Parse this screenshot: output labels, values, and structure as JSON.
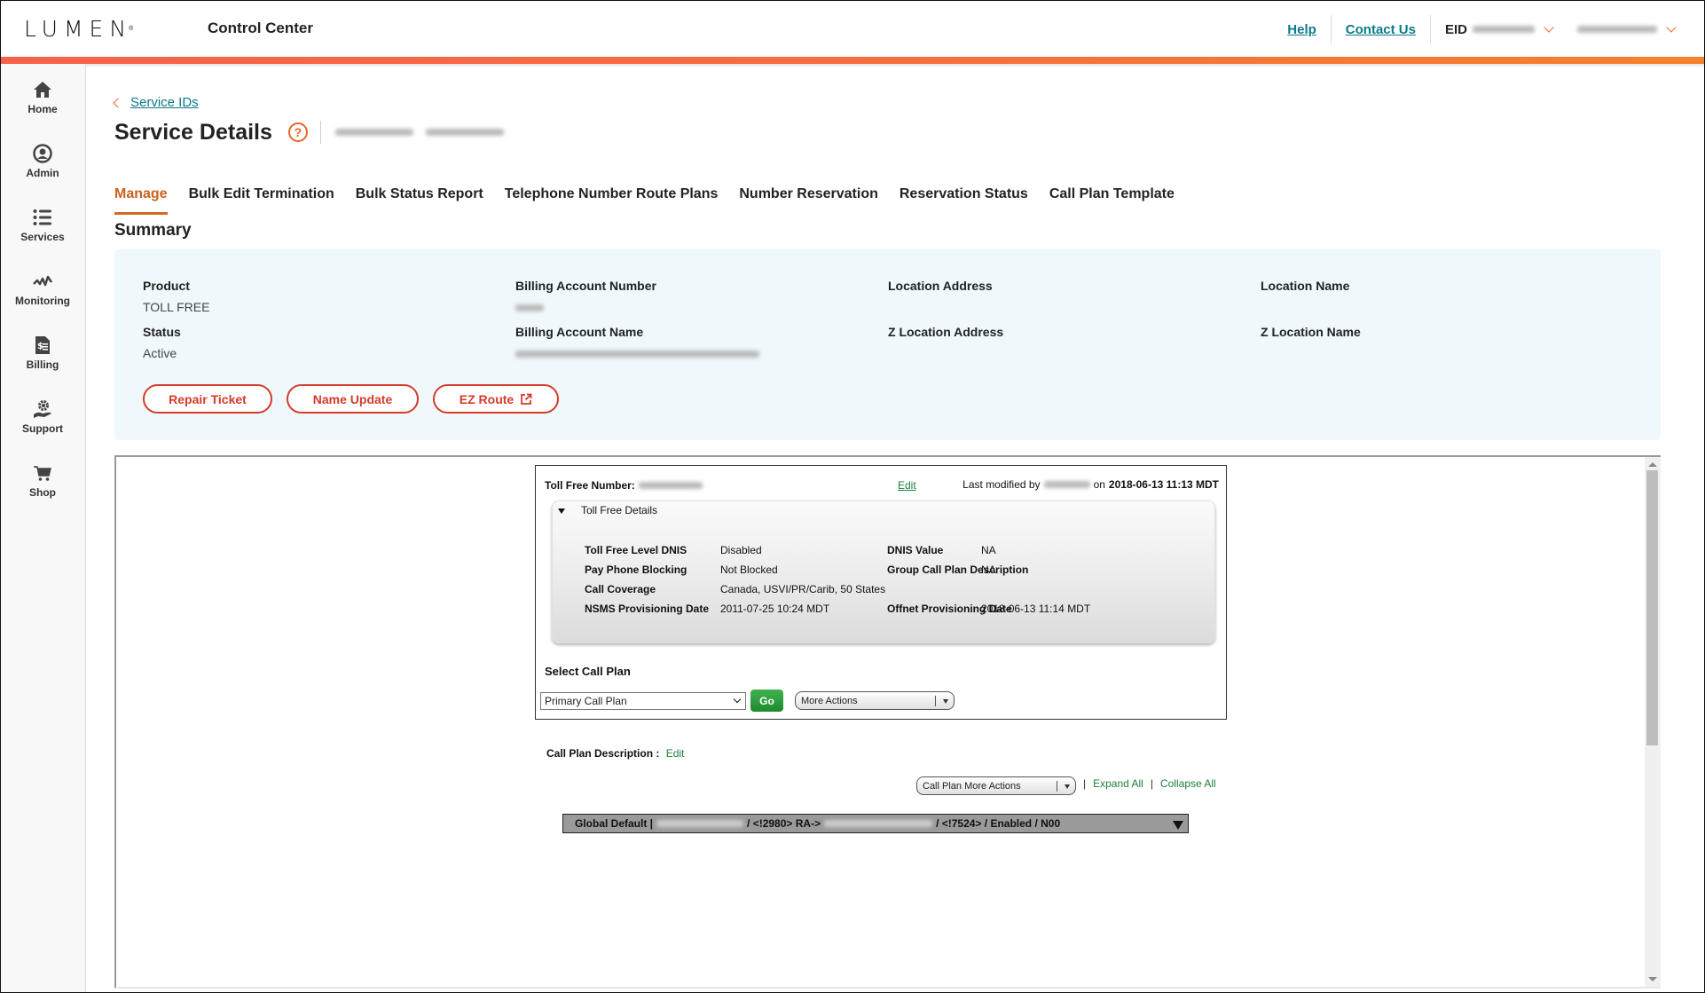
{
  "header": {
    "logo": "LUMEN",
    "app_title": "Control Center",
    "links": [
      "Help",
      "Contact Us"
    ],
    "eid_label": "EID",
    "eid_value_redacted": true,
    "user_redacted": true,
    "accent_colors": [
      "#f7614a",
      "#f6812d"
    ]
  },
  "sidebar": {
    "items": [
      {
        "label": "Home",
        "icon": "home-icon"
      },
      {
        "label": "Admin",
        "icon": "user-circle-icon"
      },
      {
        "label": "Services",
        "icon": "list-icon"
      },
      {
        "label": "Monitoring",
        "icon": "pulse-icon"
      },
      {
        "label": "Billing",
        "icon": "invoice-icon"
      },
      {
        "label": "Support",
        "icon": "support-gear-hand-icon"
      },
      {
        "label": "Shop",
        "icon": "cart-icon"
      }
    ]
  },
  "breadcrumb": {
    "back_label": "Service IDs"
  },
  "page": {
    "title": "Service Details",
    "help_glyph": "?"
  },
  "tabs": [
    {
      "label": "Manage",
      "active": true
    },
    {
      "label": "Bulk Edit Termination",
      "active": false
    },
    {
      "label": "Bulk Status Report",
      "active": false
    },
    {
      "label": "Telephone Number Route Plans",
      "active": false
    },
    {
      "label": "Number Reservation",
      "active": false
    },
    {
      "label": "Reservation Status",
      "active": false
    },
    {
      "label": "Call Plan Template",
      "active": false
    }
  ],
  "summary": {
    "title": "Summary",
    "fields": {
      "product": {
        "label": "Product",
        "value": "TOLL FREE"
      },
      "status": {
        "label": "Status",
        "value": "Active"
      },
      "ban": {
        "label": "Billing Account Number",
        "value": ""
      },
      "ban_name": {
        "label": "Billing Account Name",
        "value": ""
      },
      "loc_addr": {
        "label": "Location Address",
        "value": ""
      },
      "z_loc_addr": {
        "label": "Z Location Address",
        "value": ""
      },
      "loc_name": {
        "label": "Location Name",
        "value": ""
      },
      "z_loc_name": {
        "label": "Z Location Name",
        "value": ""
      }
    },
    "buttons": {
      "repair": "Repair Ticket",
      "name_update": "Name Update",
      "ez_route": "EZ Route"
    }
  },
  "tollfree": {
    "number_label": "Toll Free Number:",
    "edit_label": "Edit",
    "last_modified_prefix": "Last modified by",
    "last_modified_on": "on",
    "last_modified_date": "2018-06-13 11:13 MDT",
    "details_title": "Toll Free Details",
    "details": {
      "tfl_dnis_label": "Toll Free Level DNIS",
      "tfl_dnis_value": "Disabled",
      "dnis_label": "DNIS Value",
      "dnis_value": "NA",
      "ppb_label": "Pay Phone Blocking",
      "ppb_value": "Not Blocked",
      "gcpd_label": "Group Call Plan Description",
      "gcpd_value": "NA",
      "cc_label": "Call Coverage",
      "cc_value": "Canada, USVI/PR/Carib, 50 States",
      "nsms_label": "NSMS Provisioning Date",
      "nsms_value": "2011-07-25 10:24 MDT",
      "offnet_label": "Offnet Provisioning Date",
      "offnet_value": "2018-06-13 11:14 MDT"
    },
    "select_call_plan_label": "Select Call Plan",
    "call_plan_selected": "Primary Call Plan",
    "go_label": "Go",
    "more_actions_label": "More Actions",
    "call_plan_desc_label": "Call Plan Description :",
    "call_plan_desc_edit": "Edit",
    "call_plan_more_actions": "Call Plan More Actions",
    "expand_all": "Expand All",
    "collapse_all": "Collapse All",
    "separator": "|",
    "global_default": {
      "prefix": "Global Default |",
      "mid": "/ <!2980> RA->",
      "suffix": "/ <!7524> / Enabled / N00"
    }
  }
}
